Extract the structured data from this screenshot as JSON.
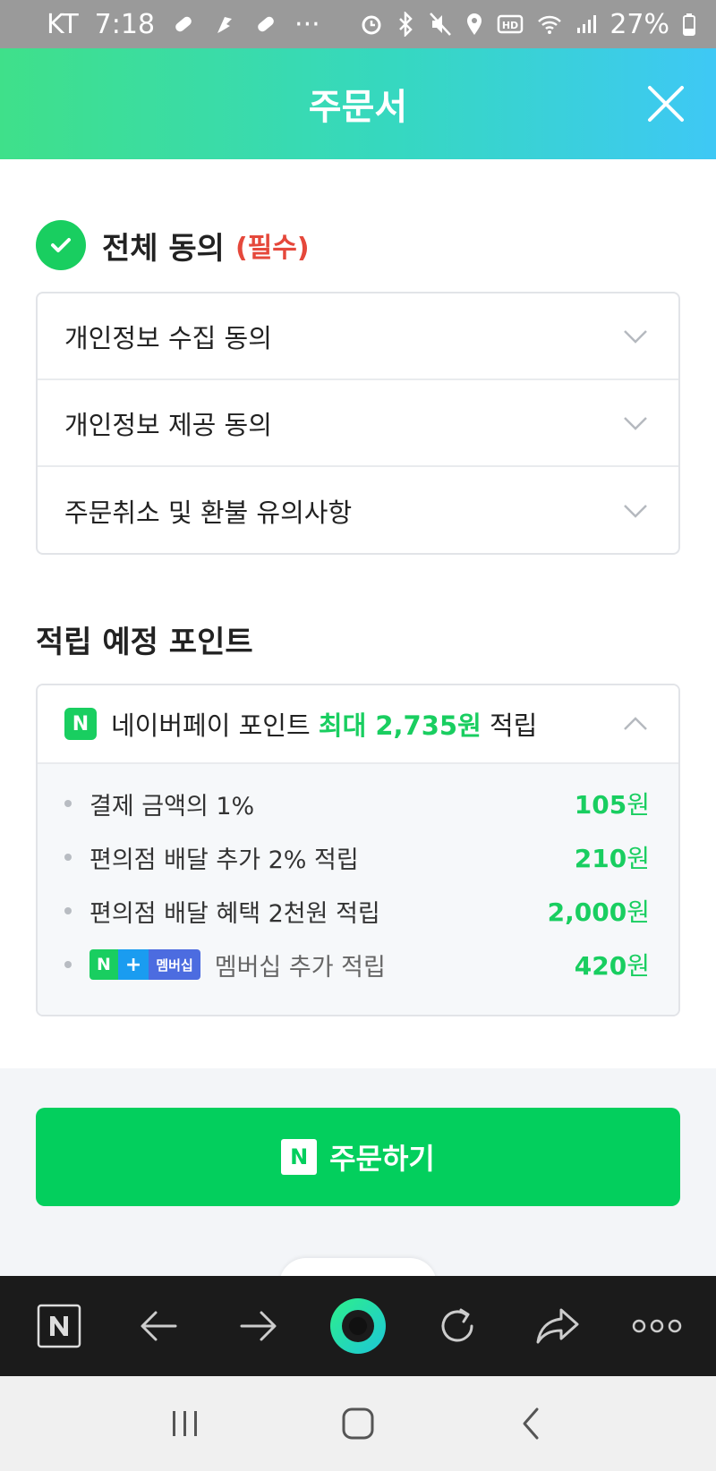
{
  "status_bar": {
    "carrier": "KT",
    "time": "7:18",
    "more": "···",
    "battery_percent": "27%"
  },
  "header": {
    "title": "주문서"
  },
  "agreement": {
    "all_label": "전체 동의",
    "required_label": "(필수)",
    "checked": true,
    "items": [
      {
        "label": "개인정보 수집 동의"
      },
      {
        "label": "개인정보 제공 동의"
      },
      {
        "label": "주문취소 및 환불 유의사항"
      }
    ]
  },
  "points": {
    "section_title": "적립 예정 포인트",
    "badge": "N",
    "head_prefix": "네이버페이 포인트",
    "head_max": "최대 2,735원",
    "head_suffix": "적립",
    "rows": [
      {
        "label": "결제 금액의 1%",
        "amount": "105",
        "unit": "원"
      },
      {
        "label": "편의점 배달 추가 2% 적립",
        "amount": "210",
        "unit": "원"
      },
      {
        "label": "편의점 배달 혜택 2천원 적립",
        "amount": "2,000",
        "unit": "원"
      }
    ],
    "membership_row": {
      "badge_n": "N",
      "badge_plus": "+",
      "badge_text": "멤버십",
      "label": "멤버십 추가 적립",
      "amount": "420",
      "unit": "원"
    }
  },
  "order_button": {
    "badge": "N",
    "label": "주문하기"
  },
  "colors": {
    "naver_green": "#03cf5d",
    "points_green": "#19ce60",
    "required_red": "#e5483b",
    "header_gradient_start": "#3fe08a",
    "header_gradient_end": "#3ec8f5"
  }
}
